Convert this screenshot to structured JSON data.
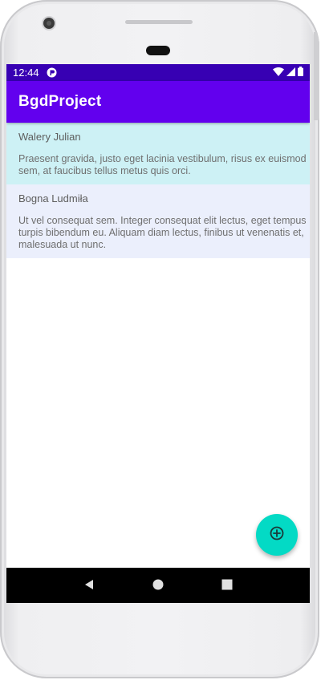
{
  "status_bar": {
    "time": "12:44",
    "app_icon": "notification-app-icon",
    "icons": [
      "wifi-icon",
      "signal-icon",
      "battery-icon"
    ],
    "color": "#3700b3"
  },
  "app_bar": {
    "title": "BgdProject",
    "color": "#6200ee"
  },
  "notes": [
    {
      "title": "Walery Julian",
      "body_lines": [
        "Praesent gravida, justo eget lacinia vestibulum, risus ex euismod",
        "sem, at faucibus tellus metus quis orci."
      ],
      "background": "#cdf1f5"
    },
    {
      "title": "Bogna Ludmiła",
      "body_lines": [
        "Ut vel consequat sem. Integer consequat elit lectus, eget tempus",
        "turpis bibendum eu. Aliquam diam lectus, finibus ut venenatis et,",
        "malesuada ut nunc."
      ],
      "background": "#ebeffc"
    }
  ],
  "fab": {
    "icon": "add-circle-icon",
    "color": "#03dac5"
  },
  "nav_bar": {
    "buttons": [
      "back-icon",
      "home-icon",
      "recents-icon"
    ]
  }
}
